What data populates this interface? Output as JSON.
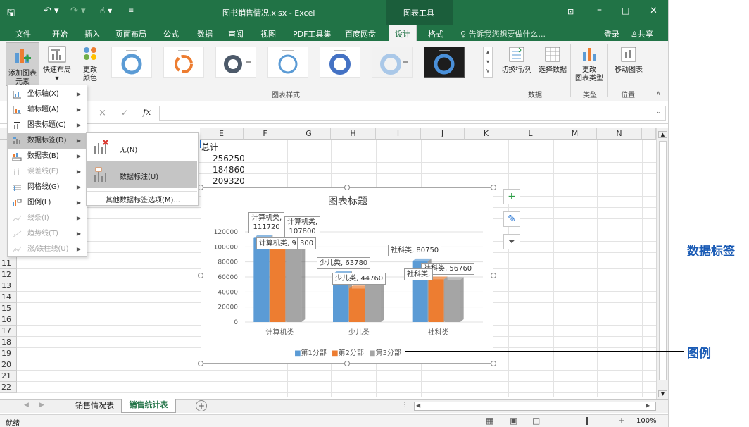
{
  "title_bar": {
    "document_title": "图书销售情况.xlsx - Excel",
    "context_tab_group": "图表工具",
    "quick_access": [
      "save-icon",
      "undo-icon",
      "redo-icon",
      "touch-mode-icon",
      "customize-icon"
    ],
    "window_controls": [
      "ribbon-options-icon",
      "minimize-icon",
      "maximize-icon",
      "close-icon"
    ]
  },
  "ribbon_tabs": [
    "文件",
    "开始",
    "插入",
    "页面布局",
    "公式",
    "数据",
    "审阅",
    "视图",
    "PDF工具集",
    "百度网盘",
    "设计",
    "格式"
  ],
  "active_tab": "设计",
  "tell_me": "告诉我您想要做什么...",
  "login": "登录",
  "share": "共享",
  "ribbon": {
    "add_element": "添加图表\n元素",
    "quick_layout": "快速布局",
    "change_color": "更改\n颜色",
    "chart_styles_group": "图表样式",
    "switch_row_col": "切换行/列",
    "select_data": "选择数据",
    "data_group": "数据",
    "change_chart_type": "更改\n图表类型",
    "type_group": "类型",
    "move_chart": "移动图表",
    "location_group": "位置"
  },
  "formula_bar": {
    "fx": "fx",
    "cancel": "×",
    "enter": "✓"
  },
  "columns": [
    "E",
    "F",
    "G",
    "H",
    "I",
    "J",
    "K",
    "L",
    "M",
    "N"
  ],
  "rows": [
    "11",
    "12",
    "13",
    "14",
    "15",
    "16",
    "17",
    "18",
    "19",
    "20",
    "21",
    "22"
  ],
  "cells": {
    "header": "总计",
    "values": [
      "256250",
      "184860",
      "209320"
    ]
  },
  "add_element_menu": [
    {
      "label": "坐标轴(X)",
      "enabled": true,
      "icon": "axes-icon"
    },
    {
      "label": "轴标题(A)",
      "enabled": true,
      "icon": "axis-titles-icon"
    },
    {
      "label": "图表标题(C)",
      "enabled": true,
      "icon": "chart-title-icon"
    },
    {
      "label": "数据标签(D)",
      "enabled": true,
      "icon": "data-labels-icon",
      "selected": true
    },
    {
      "label": "数据表(B)",
      "enabled": true,
      "icon": "data-table-icon"
    },
    {
      "label": "误差线(E)",
      "enabled": false,
      "icon": "error-bars-icon"
    },
    {
      "label": "网格线(G)",
      "enabled": true,
      "icon": "gridlines-icon"
    },
    {
      "label": "图例(L)",
      "enabled": true,
      "icon": "legend-icon"
    },
    {
      "label": "线条(I)",
      "enabled": false,
      "icon": "lines-icon"
    },
    {
      "label": "趋势线(T)",
      "enabled": false,
      "icon": "trendline-icon"
    },
    {
      "label": "涨/跌柱线(U)",
      "enabled": false,
      "icon": "up-down-bars-icon"
    }
  ],
  "data_labels_submenu": {
    "none": "无(N)",
    "callout": "数据标注(U)",
    "more": "其他数据标签选项(M)..."
  },
  "chart_data": {
    "type": "bar",
    "title": "图表标题",
    "categories": [
      "计算机类",
      "少儿类",
      "社科类"
    ],
    "series": [
      {
        "name": "第1分部",
        "values": [
          111720,
          63780,
          80750
        ],
        "color": "#5b9bd5"
      },
      {
        "name": "第2分部",
        "values": [
          109000,
          44760,
          56760
        ],
        "color": "#ed7d31"
      },
      {
        "name": "第3分部",
        "values": [
          107800,
          50000,
          56000
        ],
        "color": "#a5a5a5"
      }
    ],
    "ylim": [
      0,
      120000
    ],
    "yticks": [
      "0",
      "20000",
      "40000",
      "60000",
      "80000",
      "100000",
      "120000"
    ],
    "legend_position": "bottom",
    "grid": true,
    "data_labels": [
      "计算机类,\n111720",
      "计算机类,\n107800",
      "计算机类, 9",
      "300",
      "少儿类, 63780",
      "少儿类, 44760",
      "少儿",
      "社科类, 80750",
      "社科类, 56760",
      "社科类, "
    ]
  },
  "chart_side_buttons": [
    "plus-icon",
    "brush-icon",
    "filter-icon"
  ],
  "sheet_tabs": [
    "销售情况表",
    "销售统计表"
  ],
  "active_sheet": "销售统计表",
  "status": {
    "ready": "就绪",
    "zoom": "100%"
  },
  "annotations": [
    "数据标签",
    "图例"
  ]
}
